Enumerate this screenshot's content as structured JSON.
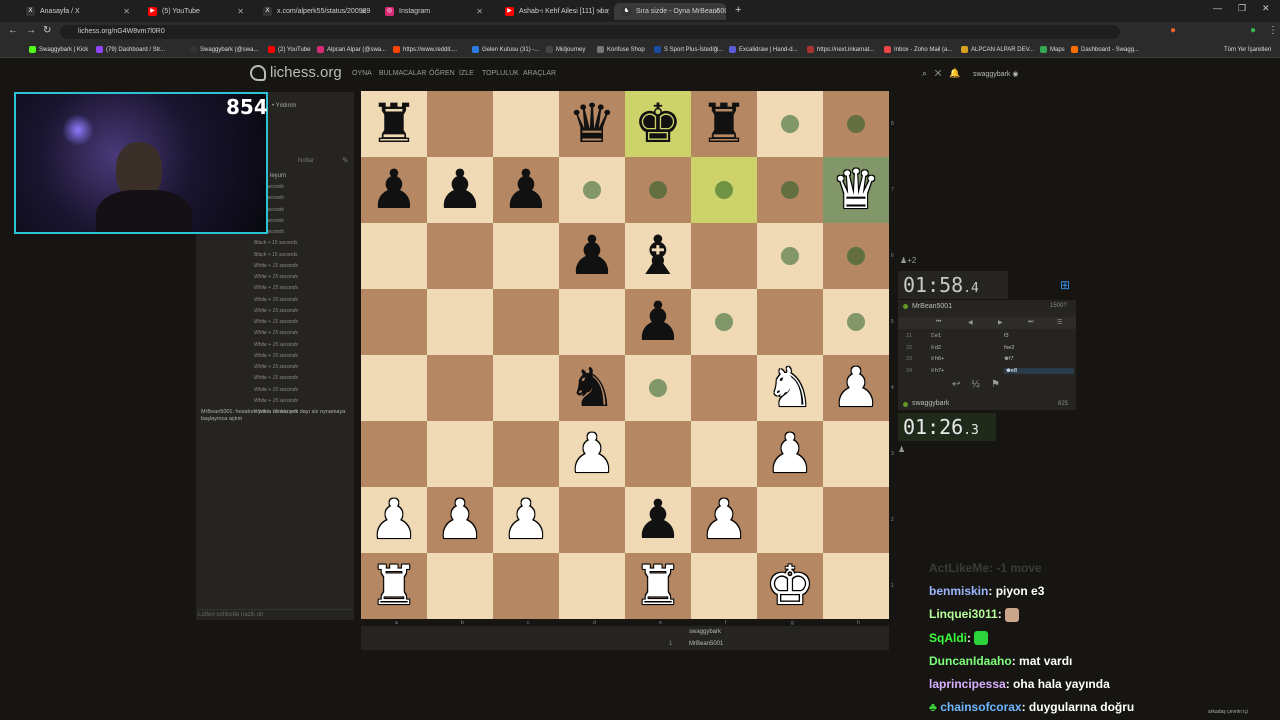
{
  "browser": {
    "tabs": [
      {
        "label": "Anasayfa / X",
        "color": "#333333",
        "icon": "X"
      },
      {
        "label": "(5) YouTube",
        "color": "#ff0000",
        "icon": "▶"
      },
      {
        "label": "x.com/alperk55/status/200989",
        "color": "#333333",
        "icon": "X"
      },
      {
        "label": "Instagram",
        "color": "#d62976",
        "icon": "◎"
      },
      {
        "label": "Ashab-ı Kehf Ailesi [111] - bayi",
        "color": "#ff0000",
        "icon": "▶"
      },
      {
        "label": "Sıra sizde - Oyna MrBean5001",
        "color": "#333333",
        "icon": "♞"
      }
    ],
    "url": "lichess.org/nG4W8vm7l0R0",
    "bookmarks": [
      "Swaggybark | Kick",
      "(79) Dashboard / Str...",
      "Swaggybark (@swa...",
      "(2) YouTube",
      "Alpcan Alpar (@swa...",
      "https://www.reddit....",
      "Gelen Kutusu (31) -...",
      "Midjourney",
      "Konfuse Shop",
      "S Sport Plus-İstediği...",
      "Excalidraw | Hand-d...",
      "https://next.inkarnat...",
      "Inbox - Zoho Mail (a...",
      "ALPCAN ALPAR DEV...",
      "Maps",
      "Dashboard - Swagg..."
    ],
    "all_bookmarks": "Tüm Yer İşaretleri"
  },
  "header": {
    "logo": "lichess.org",
    "nav": [
      "OYNA",
      "BULMACALAR",
      "ÖĞREN",
      "İZLE",
      "TOPLULUK",
      "ARAÇLAR"
    ],
    "username": "swaggybark"
  },
  "stream": {
    "viewer_count": "854"
  },
  "left_panel": {
    "mode_label": "• Yıldırım",
    "notes_tab": "Notlar",
    "lobby_label": "leyum",
    "log_lines": [
      "+ 15 seconds",
      "+ 15 seconds",
      "+ 15 seconds",
      "+ 15 seconds",
      "+ 15 seconds",
      "Black + 15 seconds",
      "Black + 15 seconds",
      "White + 15 seconds",
      "White + 15 seconds",
      "White + 15 seconds",
      "White + 15 seconds",
      "White + 15 seconds",
      "White + 15 seconds",
      "White + 15 seconds",
      "White + 15 seconds",
      "White + 15 seconds",
      "White + 15 seconds",
      "White + 15 seconds",
      "White + 15 seconds",
      "White + 15 seconds",
      "White + 15 seconds"
    ],
    "chat_message": "MrBean5001: hesabım yoktu rankta yok dayı siz oynamaya başlayınca açtım",
    "chat_placeholder": "Lütfen sohbette nazik olt"
  },
  "board": {
    "files": [
      "a",
      "b",
      "c",
      "d",
      "e",
      "f",
      "g",
      "h"
    ],
    "ranks": [
      "8",
      "7",
      "6",
      "5",
      "4",
      "3",
      "2",
      "1"
    ],
    "rows": [
      [
        "bR",
        "",
        "",
        "bQ",
        "bK",
        "bR",
        "",
        ""
      ],
      [
        "bP",
        "bP",
        "bP",
        "",
        "",
        "",
        "",
        "wQ"
      ],
      [
        "",
        "",
        "",
        "bP",
        "bB",
        "",
        "",
        ""
      ],
      [
        "",
        "",
        "",
        "",
        "bP",
        "",
        "",
        ""
      ],
      [
        "",
        "",
        "",
        "bN",
        "",
        "",
        "wN",
        "wP"
      ],
      [
        "",
        "",
        "",
        "wP",
        "",
        "",
        "wP",
        ""
      ],
      [
        "wP",
        "wP",
        "wP",
        "",
        "bP",
        "wP",
        "",
        ""
      ],
      [
        "wR",
        "",
        "",
        "",
        "wR",
        "",
        "wK",
        ""
      ]
    ],
    "last_move": [
      "e8",
      "f7"
    ],
    "selected": "h7",
    "move_dots": [
      "g8",
      "h8",
      "d7",
      "e7",
      "f7",
      "g7",
      "g6",
      "h6",
      "f5",
      "h5",
      "e4"
    ]
  },
  "underboard": {
    "white": "swaggybark",
    "black": "MrBean5001",
    "move_no": "1"
  },
  "clock_panel": {
    "captured": "♟+2",
    "opponent_time_main": "01:58",
    "opponent_time_tenth": ".4",
    "opponent_name": "MrBean5001",
    "opponent_rating": "1500?",
    "moves": [
      {
        "n": "21",
        "w": "♖e1",
        "b": "f3"
      },
      {
        "n": "22",
        "w": "♕d2",
        "b": "fxe2"
      },
      {
        "n": "23",
        "w": "♕h6+",
        "b": "♚f7"
      },
      {
        "n": "24",
        "w": "♕h7+",
        "b": "♚e8"
      }
    ],
    "my_name": "swaggybark",
    "my_rating": "825",
    "my_time_main": "01:26",
    "my_time_tenth": ".3",
    "controls": [
      "↩",
      "½",
      "⚑"
    ]
  },
  "stream_chat": [
    {
      "user": "ActLikeMe",
      "msg": ": -1 move",
      "color": "#3a3a3a",
      "faded": true
    },
    {
      "user": "benmiskin",
      "msg": ": piyon e3",
      "color": "#9bb7ff"
    },
    {
      "user": "Linquei3011",
      "msg": ":",
      "color": "#b6ff9b",
      "emote": "#c9a58a"
    },
    {
      "user": "SqAldi",
      "msg": ":",
      "color": "#3bff3b",
      "emote": "#2bd43b"
    },
    {
      "user": "DuncanIdaaho",
      "msg": ": mat vardı",
      "color": "#7dff7d"
    },
    {
      "user": "laprincipessa",
      "msg": ": oha hala yayında",
      "color": "#d8b0ff"
    },
    {
      "user": "chainsofcorax",
      "msg": ": duygularına doğru",
      "color": "#6fb7ff"
    }
  ],
  "translate_label": "arkadaş çevrim içi"
}
